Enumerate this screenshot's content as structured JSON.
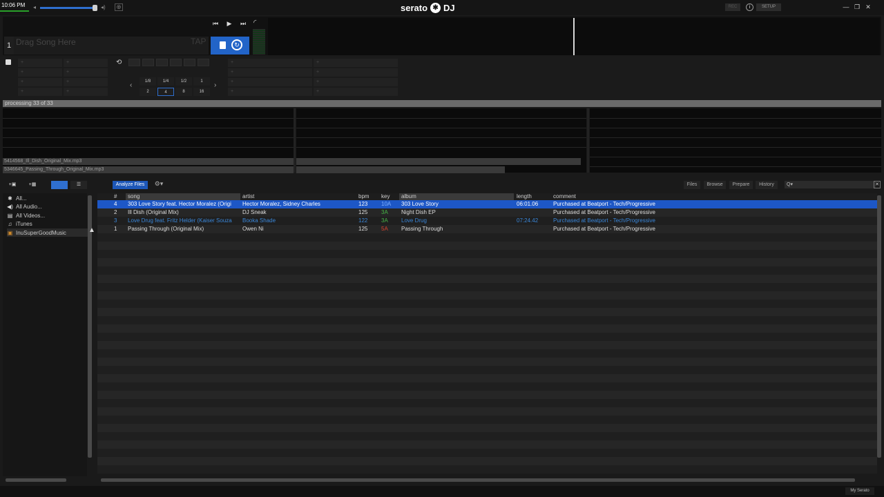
{
  "topbar": {
    "clock": "10:06 PM",
    "logo_text": "serato",
    "logo_suffix": "DJ",
    "rec_label": "REC",
    "setup_label": "SETUP",
    "info_label": "i"
  },
  "deck": {
    "number": "1",
    "drag_placeholder": "Drag Song Here",
    "tap_label": "TAP"
  },
  "loop": {
    "beats": [
      "1/8",
      "1/4",
      "1/2",
      "1",
      "2",
      "4",
      "8",
      "16"
    ],
    "active_beat": "4"
  },
  "processing": {
    "status": "processing 33 of 33"
  },
  "overview": {
    "files": [
      "5414568_Ill_Dish_Original_Mix.mp3",
      "5346645_Passing_Through_Original_Mix.mp3"
    ]
  },
  "toolbar": {
    "analyze_label": "Analyze Files",
    "files_label": "Files",
    "browse_label": "Browse",
    "prepare_label": "Prepare",
    "history_label": "History",
    "search_icon_text": "Q▾"
  },
  "sidebar": {
    "items": [
      {
        "label": "All...",
        "icon": "sparkle-icon"
      },
      {
        "label": "All Audio...",
        "icon": "speaker-icon"
      },
      {
        "label": "All Videos...",
        "icon": "film-icon"
      },
      {
        "label": "iTunes",
        "icon": "itunes-icon"
      },
      {
        "label": "InuSuperGoodMusic",
        "icon": "crate-icon"
      }
    ]
  },
  "table": {
    "columns": [
      "#",
      "song",
      "artist",
      "bpm",
      "key",
      "album",
      "length",
      "comment"
    ],
    "rows": [
      {
        "num": "4",
        "song": "303 Love Story feat. Hector Moralez (Origi",
        "artist": "Hector Moralez, Sidney Charles",
        "bpm": "123",
        "key": "10A",
        "album": "303 Love Story",
        "length": "06:01.06",
        "comment": "Purchased at Beatport - Tech/Progressive",
        "state": "selected"
      },
      {
        "num": "2",
        "song": "Ill Dish (Original Mix)",
        "artist": "DJ Sneak",
        "bpm": "125",
        "key": "3A",
        "album": "Night Dish EP",
        "length": "",
        "comment": "Purchased at Beatport - Tech/Progressive",
        "state": "normal"
      },
      {
        "num": "3",
        "song": "Love Drug feat. Fritz Helder (Kaiser Souza",
        "artist": "Booka Shade",
        "bpm": "122",
        "key": "3A",
        "album": "Love Drug",
        "length": "07:24.42",
        "comment": "Purchased at Beatport - Tech/Progressive",
        "state": "played"
      },
      {
        "num": "1",
        "song": "Passing Through (Original Mix)",
        "artist": "Owen Ni",
        "bpm": "125",
        "key": "5A",
        "album": "Passing Through",
        "length": "",
        "comment": "Purchased at Beatport - Tech/Progressive",
        "state": "normal"
      }
    ]
  },
  "footer": {
    "my_serato_label": "My Serato"
  },
  "colors": {
    "accent": "#1d57c6",
    "key_green": "#46b446",
    "key_red": "#d8442f",
    "played_blue": "#3a86d8"
  }
}
